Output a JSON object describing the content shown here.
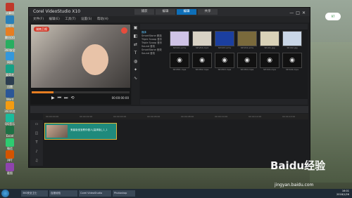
{
  "window": {
    "title": "Corel VideoStudio X10",
    "menu": [
      "文件(F)",
      "编辑(E)",
      "工具(T)",
      "设置(S)",
      "帮助(H)"
    ],
    "steps": [
      "捕获",
      "编辑",
      "编辑",
      "共享"
    ],
    "active_step": 2
  },
  "player": {
    "tv_badge": "湖南卫视",
    "timecode": "00:00:00:00",
    "progress": 0.22
  },
  "library": {
    "categories": [
      "媒体",
      "SmartStone 精选",
      "Triple Scoop 音乐",
      "Triple Scoop 音乐",
      "Sound 音效",
      "SmartStone 音效",
      "Sound 音效"
    ],
    "selected_category": 0,
    "thumbs": [
      {
        "label": "SP-V01.wmv",
        "color": "#cfc3e6"
      },
      {
        "label": "SP-V02.mp4",
        "color": "#d8d2c4"
      },
      {
        "label": "SP-V03.wmv",
        "color": "#1b3fa0"
      },
      {
        "label": "SP-V04.wmv",
        "color": "#7a6a3c"
      },
      {
        "label": "SP-I01.jpg",
        "color": "#d9d2b8"
      },
      {
        "label": "SP-I02.jpg",
        "color": "#c9d6e6"
      },
      {
        "label": "SP-M01.mpa",
        "color": "#111111"
      },
      {
        "label": "SP-M02.mpa",
        "color": "#111111"
      },
      {
        "label": "SP-M03.mpa",
        "color": "#111111"
      },
      {
        "label": "SP-M04.mpa",
        "color": "#111111"
      },
      {
        "label": "SP-S01.mpa",
        "color": "#111111"
      },
      {
        "label": "SP-S02.mpa",
        "color": "#111111"
      }
    ]
  },
  "timeline": {
    "clip_name": "鬼畜版宝宝教你做人[高清版]_1_1",
    "ruler": [
      "00:00:00:00",
      "00:00:02:00",
      "00:00:04:00",
      "00:00:06:00",
      "00:00:08:00",
      "00:00:10:00",
      "00:00:12:00",
      "00:00:14:00"
    ]
  },
  "desktop": {
    "icons": [
      "计算机",
      "回收站",
      "腾讯QQ",
      "360安全",
      "网络",
      "爱奇艺",
      "迅雷",
      "Word",
      "360浏览",
      "QQ音乐",
      "Excel",
      "微信",
      "PPT",
      "截图"
    ]
  },
  "taskbar": {
    "tasks": [
      "360安全卫士",
      "百度经验",
      "Corel VideoStudio",
      "Photoshop"
    ],
    "time": "16:01",
    "date": "2018/1/26"
  },
  "watermark": {
    "logo": "Baidu经验",
    "url": "jingyan.baidu.com"
  },
  "badge": {
    "text": "97"
  }
}
